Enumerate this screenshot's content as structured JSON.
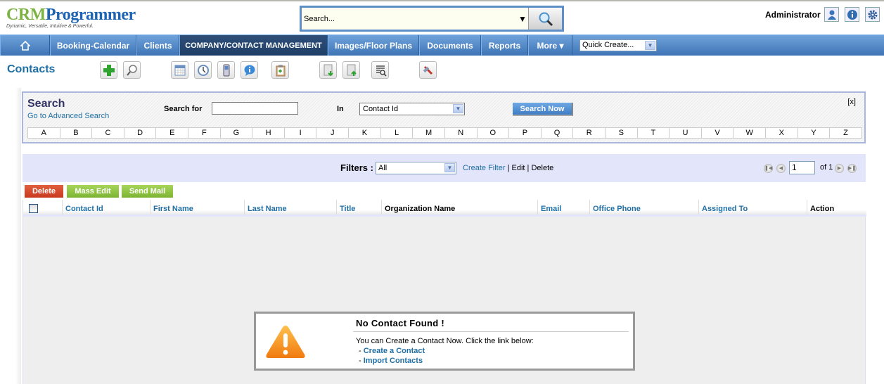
{
  "brand": {
    "part1": "CRM",
    "part2": "Programmer",
    "tagline": "Dynamic, Versatile, Intuitive & Powerful."
  },
  "global_search": {
    "placeholder": "Search...",
    "button_icon": "search-icon"
  },
  "user": {
    "name": "Administrator",
    "icons": [
      "user-icon",
      "info-icon",
      "gear-icon"
    ]
  },
  "nav": {
    "items": [
      {
        "label": "",
        "icon": "home-icon"
      },
      {
        "label": "Booking-Calendar"
      },
      {
        "label": "Clients"
      },
      {
        "label": "COMPANY/CONTACT MANAGEMENT",
        "active": true
      },
      {
        "label": "Images/Floor Plans"
      },
      {
        "label": "Documents"
      },
      {
        "label": "Reports"
      },
      {
        "label": "More ▾"
      }
    ],
    "quick_create": "Quick Create..."
  },
  "page": {
    "title": "Contacts"
  },
  "toolbar": {
    "icons": [
      "add-icon",
      "search-icon",
      "calendar-icon",
      "clock-icon",
      "mobile-phone-icon",
      "chat-info-icon",
      "clipboard-import-icon",
      "import-icon",
      "export-icon",
      "find-duplicates-icon",
      "settings-hammer-icon"
    ]
  },
  "search": {
    "heading": "Search",
    "advanced_link": "Go to Advanced Search",
    "search_for_label": "Search for",
    "search_for_value": "",
    "in_label": "In",
    "in_value": "Contact Id",
    "search_now": "Search Now",
    "close": "[x]",
    "alphabet": [
      "A",
      "B",
      "C",
      "D",
      "E",
      "F",
      "G",
      "H",
      "I",
      "J",
      "K",
      "L",
      "M",
      "N",
      "O",
      "P",
      "Q",
      "R",
      "S",
      "T",
      "U",
      "V",
      "W",
      "X",
      "Y",
      "Z"
    ]
  },
  "filters": {
    "label": "Filters :",
    "selected": "All",
    "create": "Create Filter",
    "sep1": " | ",
    "edit": "Edit",
    "sep2": " | ",
    "delete": "Delete"
  },
  "pagination": {
    "current": "1",
    "of": "of 1"
  },
  "actions": {
    "delete": "Delete",
    "mass_edit": "Mass Edit",
    "send_mail": "Send Mail"
  },
  "table": {
    "columns": [
      "Contact Id",
      "First Name",
      "Last Name",
      "Title",
      "Organization Name",
      "Email",
      "Office Phone",
      "Assigned To",
      "Action"
    ],
    "rows": []
  },
  "empty_state": {
    "title": "No Contact Found !",
    "message": "You can Create a Contact Now. Click the link below:",
    "link1": "Create a Contact",
    "link2": "Import Contacts",
    "dash": "- "
  },
  "colors": {
    "nav_blue": "#3e74b5",
    "link_blue": "#1f6fa5",
    "delete_red": "#d9452c",
    "green_btn": "#8cc63f"
  }
}
